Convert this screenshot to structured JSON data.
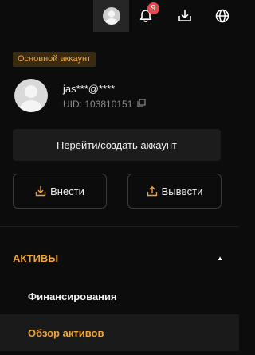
{
  "header": {
    "notification_count": "9",
    "icons": [
      "avatar-icon",
      "bell-icon",
      "download-icon",
      "globe-icon"
    ]
  },
  "account": {
    "tag": "Основной аккаунт",
    "username": "jas***@****",
    "uid": "UID: 103810151",
    "switch_button": "Перейти/создать аккаунт",
    "deposit_button": "Внести",
    "withdraw_button": "Вывести"
  },
  "menu": {
    "section_title": "АКТИВЫ",
    "items": [
      {
        "label": "Финансирования",
        "active": false
      },
      {
        "label": "Обзор активов",
        "active": true
      }
    ]
  },
  "colors": {
    "accent": "#f0a538",
    "background": "#0c0c0c",
    "badge": "#e5484d"
  }
}
